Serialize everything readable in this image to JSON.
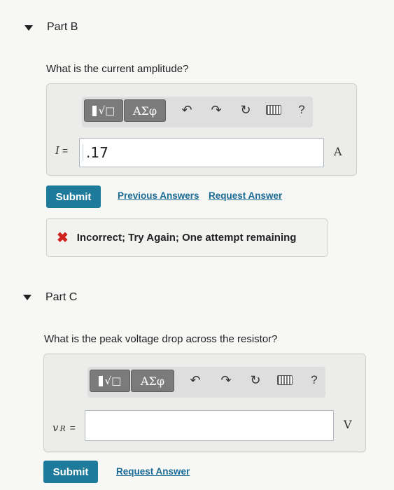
{
  "part_b": {
    "title": "Part B",
    "question": "What is the current amplitude?",
    "toolbar": {
      "templates_label": "√□",
      "greek_label": "ΑΣφ",
      "help_label": "?"
    },
    "equation": {
      "label_var": "I",
      "label_eq": "="
    },
    "answer": {
      "value": ".17",
      "unit": "A"
    },
    "submit_label": "Submit",
    "previous_answers_label": "Previous Answers",
    "request_answer_label": "Request Answer",
    "feedback": "Incorrect; Try Again; One attempt remaining"
  },
  "part_c": {
    "title": "Part C",
    "question": "What is the peak voltage drop across the resistor?",
    "toolbar": {
      "templates_label": "√□",
      "greek_label": "ΑΣφ",
      "help_label": "?"
    },
    "equation": {
      "label_var": "v",
      "label_sub": "R",
      "label_eq": "="
    },
    "answer": {
      "value": "",
      "unit": "V"
    },
    "submit_label": "Submit",
    "request_answer_label": "Request Answer"
  }
}
